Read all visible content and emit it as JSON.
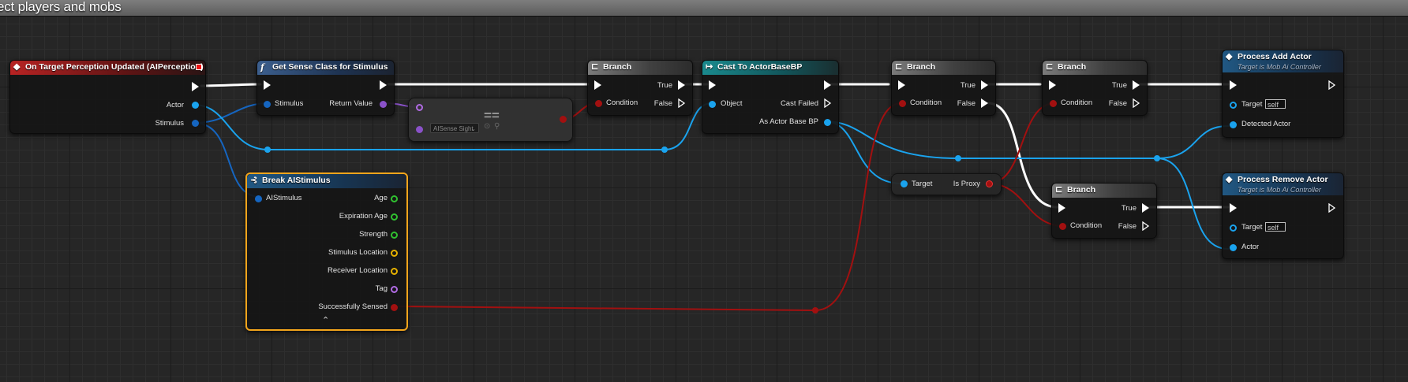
{
  "comment": {
    "title": "ect players and mobs"
  },
  "colors": {
    "exec": "#ffffff",
    "object": "#1aa3ee",
    "class": "#8a52c9",
    "bool": "#a21010",
    "struct": "#1565c0",
    "selection": "#f3a51c"
  },
  "nodes": {
    "perception": {
      "title": "On Target Perception Updated (AIPerception)",
      "icon": "event-icon",
      "pins": {
        "actor": "Actor",
        "stimulus": "Stimulus"
      }
    },
    "get_sense": {
      "title": "Get Sense Class for Stimulus",
      "icon": "function-icon",
      "pins": {
        "stimulus": "Stimulus",
        "return_value": "Return Value"
      }
    },
    "equal": {
      "operator": "==",
      "dropdown_value": "AISense Sight"
    },
    "branch1": {
      "title": "Branch",
      "pins": {
        "true": "True",
        "false": "False",
        "condition": "Condition"
      }
    },
    "cast": {
      "title": "Cast To ActorBaseBP",
      "pins": {
        "object": "Object",
        "cast_failed": "Cast Failed",
        "as_actor": "As Actor Base BP"
      }
    },
    "branch2": {
      "title": "Branch",
      "pins": {
        "true": "True",
        "false": "False",
        "condition": "Condition"
      }
    },
    "branch3": {
      "title": "Branch",
      "pins": {
        "true": "True",
        "false": "False",
        "condition": "Condition"
      }
    },
    "branch4": {
      "title": "Branch",
      "pins": {
        "true": "True",
        "false": "False",
        "condition": "Condition"
      }
    },
    "is_proxy": {
      "target": "Target",
      "output": "Is Proxy"
    },
    "break": {
      "title": "Break AIStimulus",
      "pins": {
        "input": "AIStimulus",
        "age": "Age",
        "expiration_age": "Expiration Age",
        "strength": "Strength",
        "stimulus_location": "Stimulus Location",
        "receiver_location": "Receiver Location",
        "tag": "Tag",
        "successfully_sensed": "Successfully Sensed"
      }
    },
    "add_actor": {
      "title": "Process Add Actor",
      "subtitle": "Target is Mob Ai Controller",
      "pins": {
        "target": "Target",
        "target_value": "self",
        "detected": "Detected Actor"
      }
    },
    "remove_actor": {
      "title": "Process Remove Actor",
      "subtitle": "Target is Mob Ai Controller",
      "pins": {
        "target": "Target",
        "target_value": "self",
        "actor": "Actor"
      }
    }
  }
}
